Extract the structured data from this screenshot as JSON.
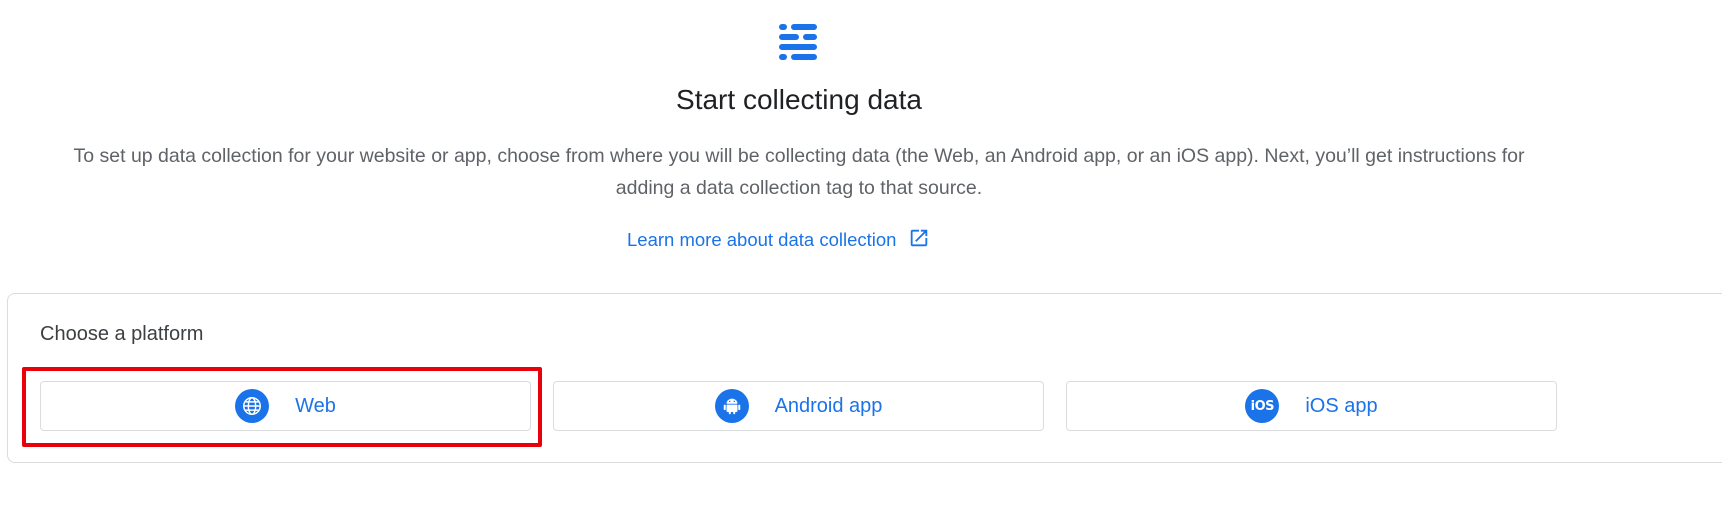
{
  "header": {
    "icon": "data-stream-icon",
    "title": "Start collecting data",
    "description": "To set up data collection for your website or app, choose from where you will be collecting data (the Web, an Android app, or an iOS app). Next, you’ll get instructions for adding a data collection tag to that source.",
    "learn_more_label": "Learn more about data collection",
    "learn_more_icon": "open-in-new-icon"
  },
  "platform": {
    "heading": "Choose a platform",
    "options": [
      {
        "label": "Web",
        "icon": "globe-icon"
      },
      {
        "label": "Android app",
        "icon": "android-icon"
      },
      {
        "label": "iOS app",
        "icon": "ios-icon",
        "icon_text": "iOS"
      }
    ],
    "highlighted": "Web"
  },
  "colors": {
    "accent": "#1a73e8",
    "highlight": "#e8000b",
    "border": "#dadce0"
  }
}
